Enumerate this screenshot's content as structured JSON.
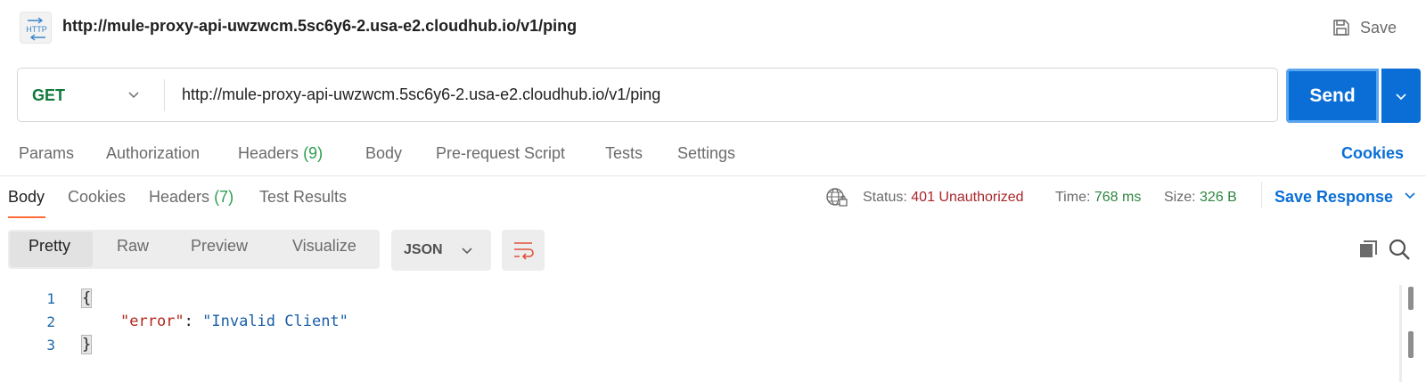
{
  "request": {
    "icon": "http-icon",
    "icon_text": "HTTP",
    "title": "http://mule-proxy-api-uwzwcm.5sc6y6-2.usa-e2.cloudhub.io/v1/ping",
    "save_label": "Save",
    "method": "GET",
    "url": "http://mule-proxy-api-uwzwcm.5sc6y6-2.usa-e2.cloudhub.io/v1/ping",
    "send_label": "Send"
  },
  "request_tabs": [
    {
      "label": "Params"
    },
    {
      "label": "Authorization"
    },
    {
      "label": "Headers",
      "count": "(9)"
    },
    {
      "label": "Body"
    },
    {
      "label": "Pre-request Script"
    },
    {
      "label": "Tests"
    },
    {
      "label": "Settings"
    }
  ],
  "cookies_label": "Cookies",
  "response_tabs": [
    {
      "label": "Body"
    },
    {
      "label": "Cookies"
    },
    {
      "label": "Headers",
      "count": "(7)"
    },
    {
      "label": "Test Results"
    }
  ],
  "status": {
    "status_label": "Status:",
    "status_value": "401 Unauthorized",
    "time_label": "Time:",
    "time_value": "768 ms",
    "size_label": "Size:",
    "size_value": "326 B"
  },
  "save_response_label": "Save Response",
  "view_modes": [
    "Pretty",
    "Raw",
    "Preview",
    "Visualize"
  ],
  "format": "JSON",
  "code": {
    "line_numbers": [
      "1",
      "2",
      "3"
    ],
    "open_brace": "{",
    "key": "\"error\"",
    "colon": ": ",
    "value": "\"Invalid Client\"",
    "close_brace": "}"
  },
  "colors": {
    "accent": "#0a6ed6",
    "method_get": "#0f7a3b",
    "status_error": "#a8262b",
    "ok": "#2e8540",
    "active_tab": "#ff6c37"
  }
}
